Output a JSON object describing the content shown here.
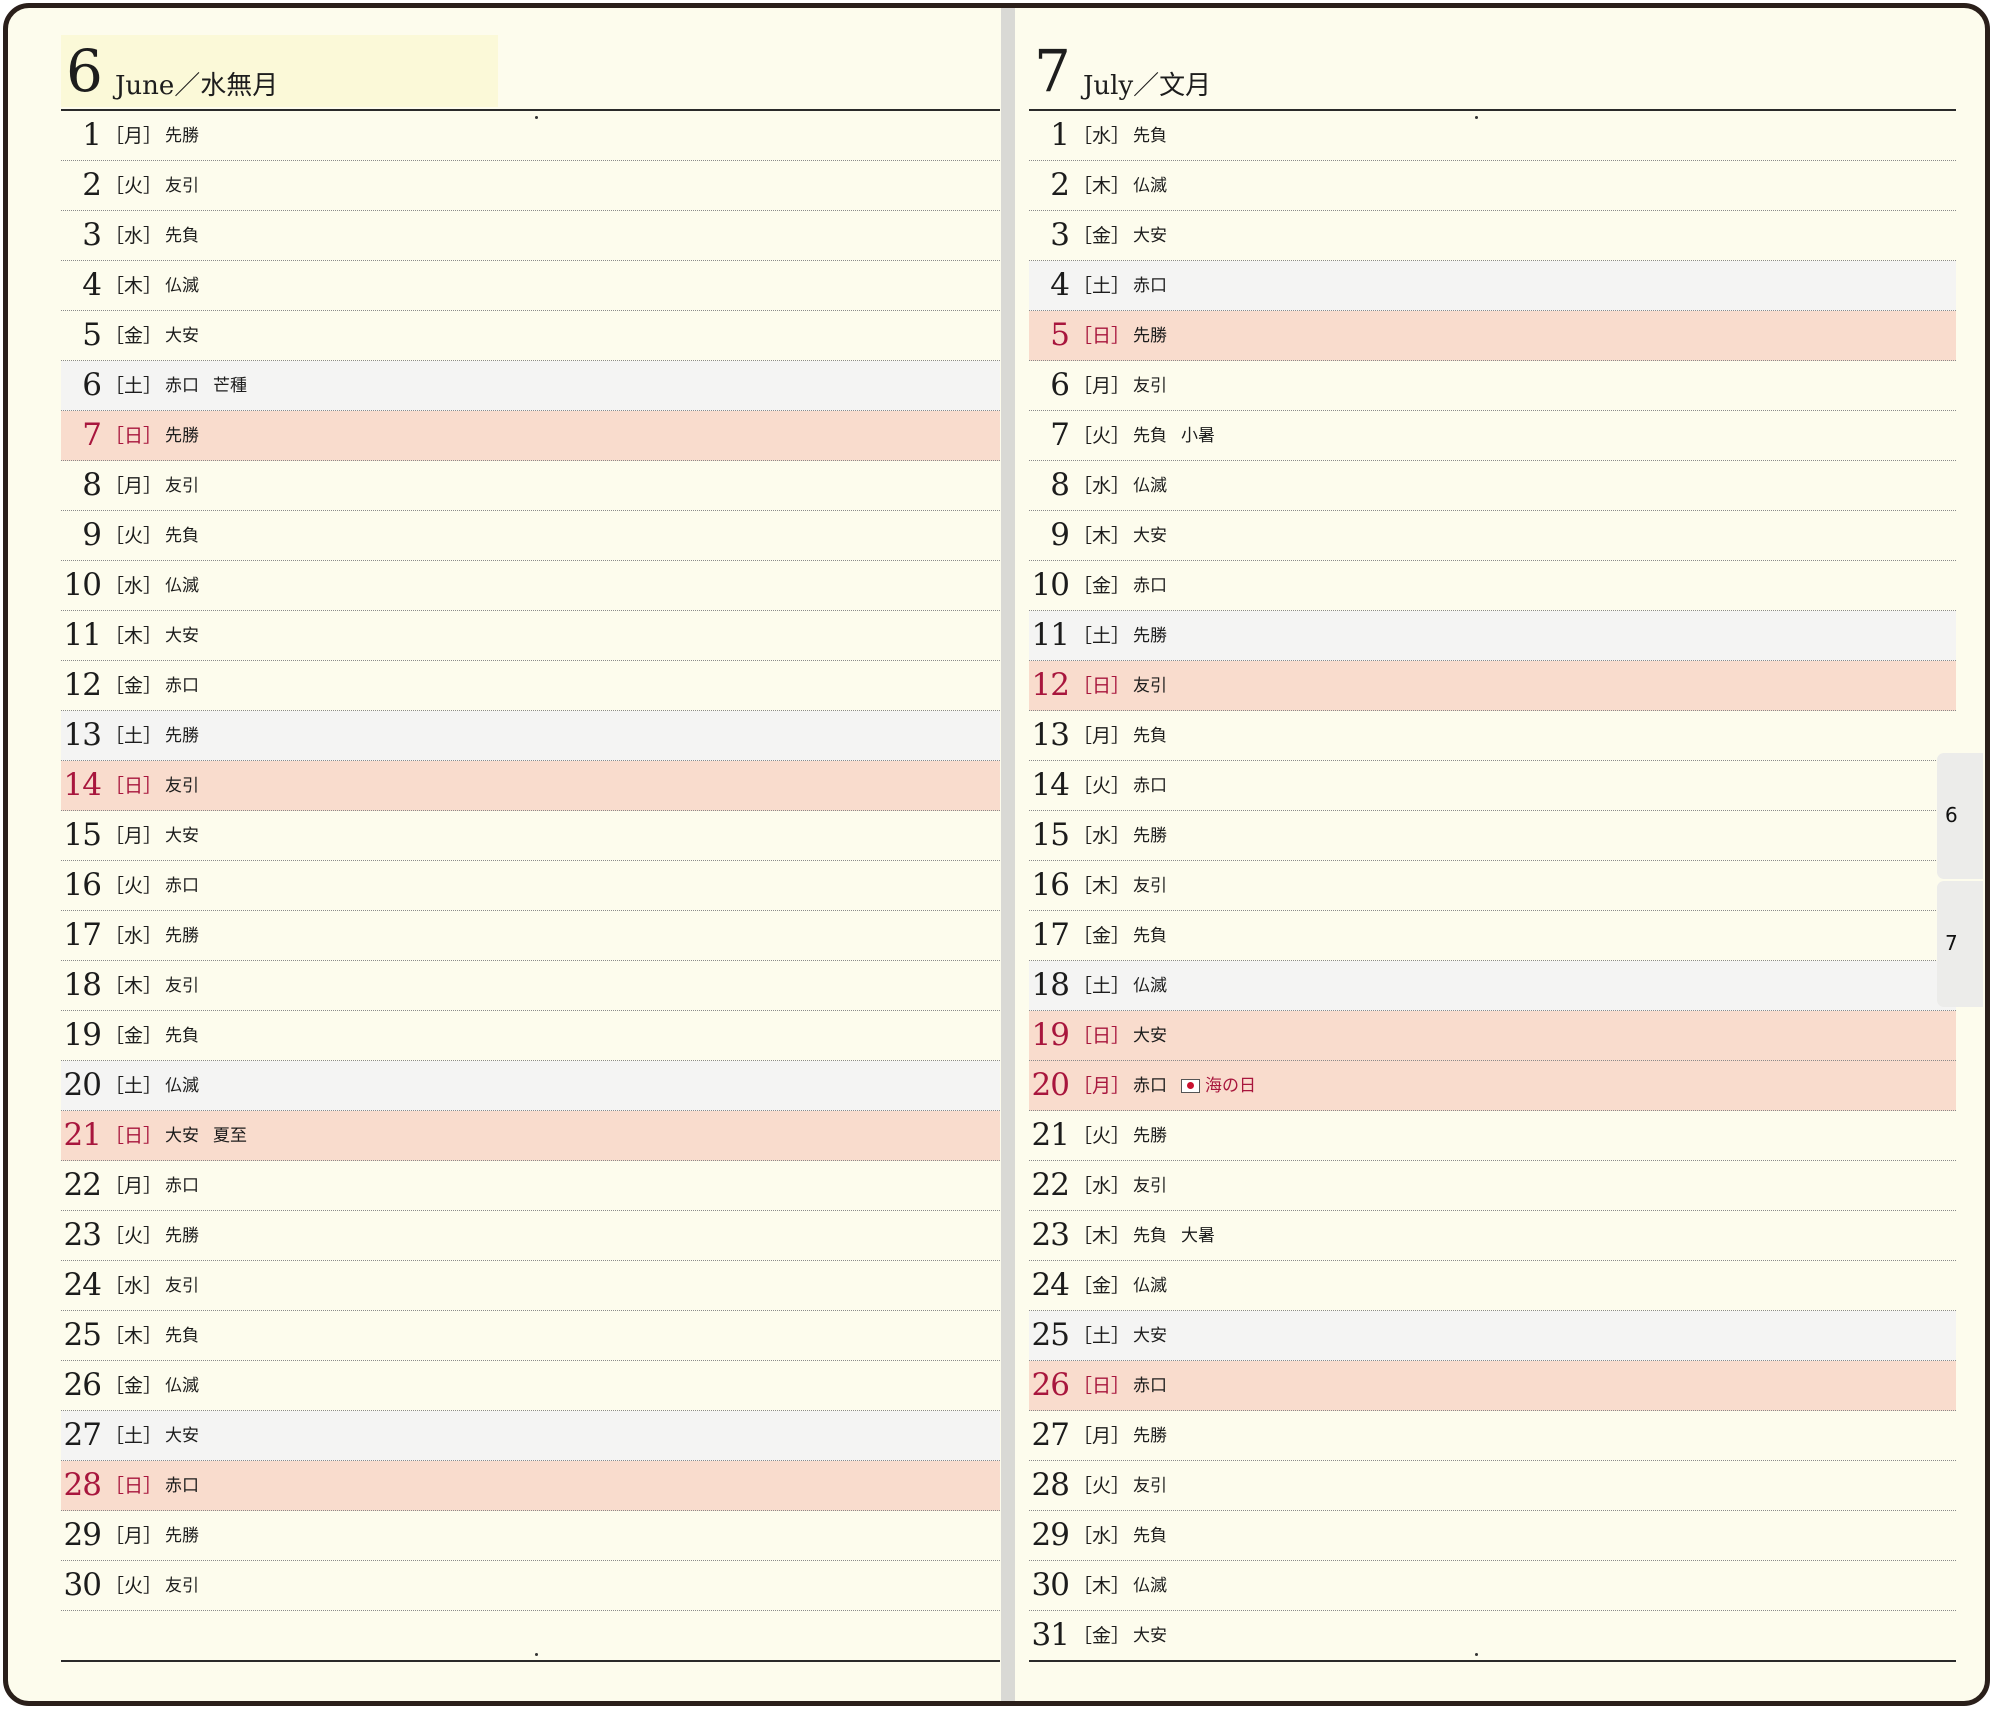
{
  "pages": [
    {
      "month_number": "6",
      "month_name": "June／水無月",
      "days": [
        {
          "date": "1",
          "weekday": "［月］",
          "rokuyo": "先勝",
          "event": "",
          "type": ""
        },
        {
          "date": "2",
          "weekday": "［火］",
          "rokuyo": "友引",
          "event": "",
          "type": ""
        },
        {
          "date": "3",
          "weekday": "［水］",
          "rokuyo": "先負",
          "event": "",
          "type": ""
        },
        {
          "date": "4",
          "weekday": "［木］",
          "rokuyo": "仏滅",
          "event": "",
          "type": ""
        },
        {
          "date": "5",
          "weekday": "［金］",
          "rokuyo": "大安",
          "event": "",
          "type": ""
        },
        {
          "date": "6",
          "weekday": "［土］",
          "rokuyo": "赤口",
          "event": "芒種",
          "type": "sat"
        },
        {
          "date": "7",
          "weekday": "［日］",
          "rokuyo": "先勝",
          "event": "",
          "type": "sun"
        },
        {
          "date": "8",
          "weekday": "［月］",
          "rokuyo": "友引",
          "event": "",
          "type": ""
        },
        {
          "date": "9",
          "weekday": "［火］",
          "rokuyo": "先負",
          "event": "",
          "type": ""
        },
        {
          "date": "10",
          "weekday": "［水］",
          "rokuyo": "仏滅",
          "event": "",
          "type": ""
        },
        {
          "date": "11",
          "weekday": "［木］",
          "rokuyo": "大安",
          "event": "",
          "type": ""
        },
        {
          "date": "12",
          "weekday": "［金］",
          "rokuyo": "赤口",
          "event": "",
          "type": ""
        },
        {
          "date": "13",
          "weekday": "［土］",
          "rokuyo": "先勝",
          "event": "",
          "type": "sat"
        },
        {
          "date": "14",
          "weekday": "［日］",
          "rokuyo": "友引",
          "event": "",
          "type": "sun"
        },
        {
          "date": "15",
          "weekday": "［月］",
          "rokuyo": "大安",
          "event": "",
          "type": ""
        },
        {
          "date": "16",
          "weekday": "［火］",
          "rokuyo": "赤口",
          "event": "",
          "type": ""
        },
        {
          "date": "17",
          "weekday": "［水］",
          "rokuyo": "先勝",
          "event": "",
          "type": ""
        },
        {
          "date": "18",
          "weekday": "［木］",
          "rokuyo": "友引",
          "event": "",
          "type": ""
        },
        {
          "date": "19",
          "weekday": "［金］",
          "rokuyo": "先負",
          "event": "",
          "type": ""
        },
        {
          "date": "20",
          "weekday": "［土］",
          "rokuyo": "仏滅",
          "event": "",
          "type": "sat"
        },
        {
          "date": "21",
          "weekday": "［日］",
          "rokuyo": "大安",
          "event": "夏至",
          "type": "sun"
        },
        {
          "date": "22",
          "weekday": "［月］",
          "rokuyo": "赤口",
          "event": "",
          "type": ""
        },
        {
          "date": "23",
          "weekday": "［火］",
          "rokuyo": "先勝",
          "event": "",
          "type": ""
        },
        {
          "date": "24",
          "weekday": "［水］",
          "rokuyo": "友引",
          "event": "",
          "type": ""
        },
        {
          "date": "25",
          "weekday": "［木］",
          "rokuyo": "先負",
          "event": "",
          "type": ""
        },
        {
          "date": "26",
          "weekday": "［金］",
          "rokuyo": "仏滅",
          "event": "",
          "type": ""
        },
        {
          "date": "27",
          "weekday": "［土］",
          "rokuyo": "大安",
          "event": "",
          "type": "sat"
        },
        {
          "date": "28",
          "weekday": "［日］",
          "rokuyo": "赤口",
          "event": "",
          "type": "sun"
        },
        {
          "date": "29",
          "weekday": "［月］",
          "rokuyo": "先勝",
          "event": "",
          "type": ""
        },
        {
          "date": "30",
          "weekday": "［火］",
          "rokuyo": "友引",
          "event": "",
          "type": ""
        }
      ]
    },
    {
      "month_number": "7",
      "month_name": "July／文月",
      "days": [
        {
          "date": "1",
          "weekday": "［水］",
          "rokuyo": "先負",
          "event": "",
          "type": ""
        },
        {
          "date": "2",
          "weekday": "［木］",
          "rokuyo": "仏滅",
          "event": "",
          "type": ""
        },
        {
          "date": "3",
          "weekday": "［金］",
          "rokuyo": "大安",
          "event": "",
          "type": ""
        },
        {
          "date": "4",
          "weekday": "［土］",
          "rokuyo": "赤口",
          "event": "",
          "type": "sat"
        },
        {
          "date": "5",
          "weekday": "［日］",
          "rokuyo": "先勝",
          "event": "",
          "type": "sun"
        },
        {
          "date": "6",
          "weekday": "［月］",
          "rokuyo": "友引",
          "event": "",
          "type": ""
        },
        {
          "date": "7",
          "weekday": "［火］",
          "rokuyo": "先負",
          "event": "小暑",
          "type": ""
        },
        {
          "date": "8",
          "weekday": "［水］",
          "rokuyo": "仏滅",
          "event": "",
          "type": ""
        },
        {
          "date": "9",
          "weekday": "［木］",
          "rokuyo": "大安",
          "event": "",
          "type": ""
        },
        {
          "date": "10",
          "weekday": "［金］",
          "rokuyo": "赤口",
          "event": "",
          "type": ""
        },
        {
          "date": "11",
          "weekday": "［土］",
          "rokuyo": "先勝",
          "event": "",
          "type": "sat"
        },
        {
          "date": "12",
          "weekday": "［日］",
          "rokuyo": "友引",
          "event": "",
          "type": "sun"
        },
        {
          "date": "13",
          "weekday": "［月］",
          "rokuyo": "先負",
          "event": "",
          "type": ""
        },
        {
          "date": "14",
          "weekday": "［火］",
          "rokuyo": "赤口",
          "event": "",
          "type": ""
        },
        {
          "date": "15",
          "weekday": "［水］",
          "rokuyo": "先勝",
          "event": "",
          "type": ""
        },
        {
          "date": "16",
          "weekday": "［木］",
          "rokuyo": "友引",
          "event": "",
          "type": ""
        },
        {
          "date": "17",
          "weekday": "［金］",
          "rokuyo": "先負",
          "event": "",
          "type": ""
        },
        {
          "date": "18",
          "weekday": "［土］",
          "rokuyo": "仏滅",
          "event": "",
          "type": "sat"
        },
        {
          "date": "19",
          "weekday": "［日］",
          "rokuyo": "大安",
          "event": "",
          "type": "sun"
        },
        {
          "date": "20",
          "weekday": "［月］",
          "rokuyo": "赤口",
          "event": "海の日",
          "type": "holiday",
          "event_icon": "japan-flag-icon"
        },
        {
          "date": "21",
          "weekday": "［火］",
          "rokuyo": "先勝",
          "event": "",
          "type": ""
        },
        {
          "date": "22",
          "weekday": "［水］",
          "rokuyo": "友引",
          "event": "",
          "type": ""
        },
        {
          "date": "23",
          "weekday": "［木］",
          "rokuyo": "先負",
          "event": "大暑",
          "type": ""
        },
        {
          "date": "24",
          "weekday": "［金］",
          "rokuyo": "仏滅",
          "event": "",
          "type": ""
        },
        {
          "date": "25",
          "weekday": "［土］",
          "rokuyo": "大安",
          "event": "",
          "type": "sat"
        },
        {
          "date": "26",
          "weekday": "［日］",
          "rokuyo": "赤口",
          "event": "",
          "type": "sun"
        },
        {
          "date": "27",
          "weekday": "［月］",
          "rokuyo": "先勝",
          "event": "",
          "type": ""
        },
        {
          "date": "28",
          "weekday": "［火］",
          "rokuyo": "友引",
          "event": "",
          "type": ""
        },
        {
          "date": "29",
          "weekday": "［水］",
          "rokuyo": "先負",
          "event": "",
          "type": ""
        },
        {
          "date": "30",
          "weekday": "［木］",
          "rokuyo": "仏滅",
          "event": "",
          "type": ""
        },
        {
          "date": "31",
          "weekday": "［金］",
          "rokuyo": "大安",
          "event": "",
          "type": ""
        }
      ]
    }
  ],
  "tabs": [
    "6",
    "7"
  ],
  "colors": {
    "sunday_holiday_red": "#a8163d",
    "sunday_row_bg": "#f9dccd",
    "saturday_row_bg": "#f4f4f3",
    "paper": "#fdfced"
  }
}
